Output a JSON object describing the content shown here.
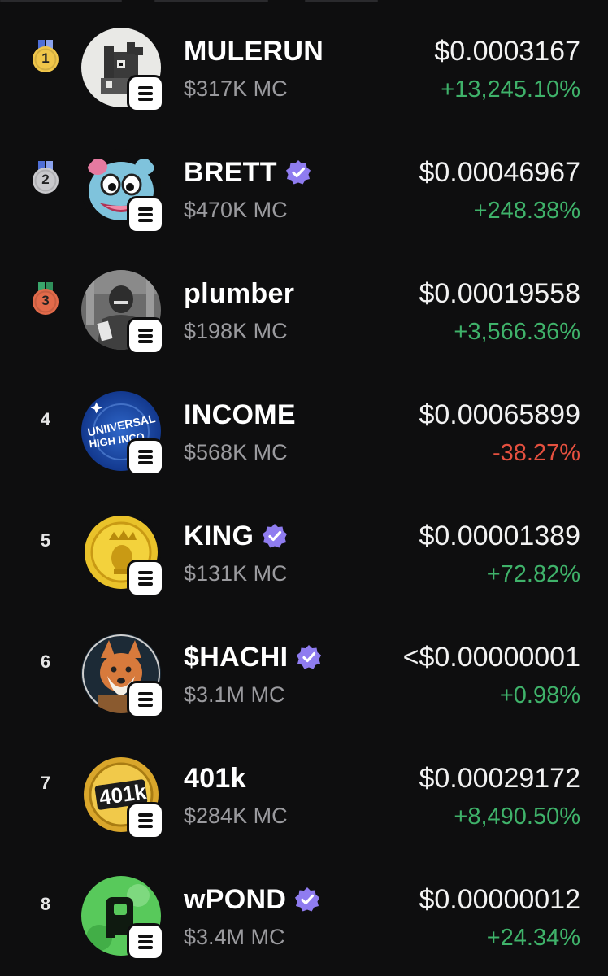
{
  "colors": {
    "background": "#0e0e0f",
    "positive": "#3fb26a",
    "negative": "#e5503f",
    "verified": "#8f7cf0",
    "muted_text": "#9a9a9e",
    "medal_gold": "#f0c64a",
    "medal_silver": "#c9c9cc",
    "medal_bronze": "#e26a4a"
  },
  "tokens": [
    {
      "rank": "1",
      "medal": "gold",
      "name": "MULERUN",
      "verified": false,
      "mc": "$317K MC",
      "price": "$0.0003167",
      "change": "+13,245.10%",
      "direction": "up",
      "avatar_icon": "pixel-mule-avatar",
      "chain_icon": "solana-icon"
    },
    {
      "rank": "2",
      "medal": "silver",
      "name": "BRETT",
      "verified": true,
      "mc": "$470K MC",
      "price": "$0.00046967",
      "change": "+248.38%",
      "direction": "up",
      "avatar_icon": "brett-creature-avatar",
      "chain_icon": "solana-icon"
    },
    {
      "rank": "3",
      "medal": "bronze",
      "name": "plumber",
      "verified": false,
      "mc": "$198K MC",
      "price": "$0.00019558",
      "change": "+3,566.36%",
      "direction": "up",
      "avatar_icon": "plumber-photo-avatar",
      "chain_icon": "solana-icon"
    },
    {
      "rank": "4",
      "medal": null,
      "name": "INCOME",
      "verified": false,
      "mc": "$568K MC",
      "price": "$0.00065899",
      "change": "-38.27%",
      "direction": "down",
      "avatar_icon": "income-globe-avatar",
      "avatar_text": "UNIIVERSAL HIGH INCO",
      "chain_icon": "solana-icon"
    },
    {
      "rank": "5",
      "medal": null,
      "name": "KING",
      "verified": true,
      "mc": "$131K MC",
      "price": "$0.00001389",
      "change": "+72.82%",
      "direction": "up",
      "avatar_icon": "gold-coin-crown-avatar",
      "chain_icon": "solana-icon"
    },
    {
      "rank": "6",
      "medal": null,
      "name": "$HACHI",
      "verified": true,
      "mc": "$3.1M MC",
      "price": "<$0.00000001",
      "change": "+0.98%",
      "direction": "up",
      "avatar_icon": "shiba-dog-avatar",
      "chain_icon": "solana-icon"
    },
    {
      "rank": "7",
      "medal": null,
      "name": "401k",
      "verified": false,
      "mc": "$284K MC",
      "price": "$0.00029172",
      "change": "+8,490.50%",
      "direction": "up",
      "avatar_icon": "gold-401k-coin-avatar",
      "avatar_text": "401k",
      "chain_icon": "solana-icon"
    },
    {
      "rank": "8",
      "medal": null,
      "name": "wPOND",
      "verified": true,
      "mc": "$3.4M MC",
      "price": "$0.00000012",
      "change": "+24.34%",
      "direction": "up",
      "avatar_icon": "green-pond-avatar",
      "chain_icon": "solana-icon"
    }
  ]
}
